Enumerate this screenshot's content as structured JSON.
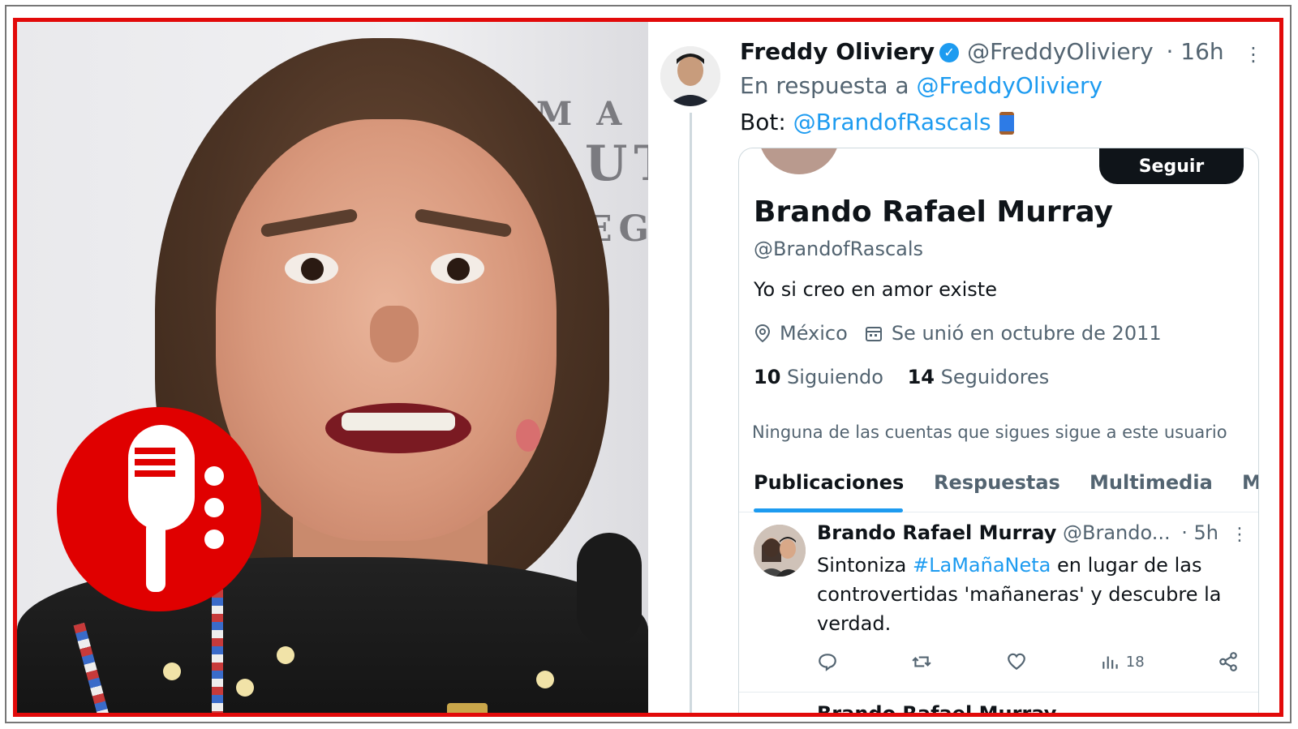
{
  "colors": {
    "frame_red": "#e20a0a",
    "link": "#1d9bf0",
    "text_primary": "#0f1419",
    "text_secondary": "#536471"
  },
  "tweet": {
    "author_name": "Freddy Oliviery",
    "author_handle": "@FreddyOliviery",
    "time": "· 16h",
    "reply_prefix": "En respuesta a",
    "reply_to": "@FreddyOliviery",
    "bot_prefix": "Bot:",
    "bot_handle": "@BrandofRascals"
  },
  "profile_card": {
    "follow_label": "Seguir",
    "name": "Brando Rafael Murray",
    "handle": "@BrandofRascals",
    "bio": "Yo si creo en amor existe",
    "location": "México",
    "joined": "Se unió en octubre de 2011",
    "following_count": "10",
    "following_label": "Siguiendo",
    "followers_count": "14",
    "followers_label": "Seguidores",
    "note": "Ninguna de las cuentas que sigues sigue a este usuario",
    "tabs": [
      "Publicaciones",
      "Respuestas",
      "Multimedia",
      "M"
    ]
  },
  "post": {
    "author_name": "Brando Rafael Murray",
    "author_handle": "@Brando...",
    "time": "· 5h",
    "text_before": "Sintoniza ",
    "hashtag": "#LaMañaNeta",
    "text_after": " en lugar de las controvertidas 'mañaneras' y descubre la verdad.",
    "views": "18"
  },
  "next_post": {
    "author_name": "Brando Rafael Murray"
  },
  "icons": [
    "verified-icon",
    "spool-icon",
    "location-icon",
    "calendar-icon",
    "reply-icon",
    "retweet-icon",
    "like-icon",
    "views-icon",
    "share-icon",
    "microphone-icon",
    "more-icon"
  ]
}
